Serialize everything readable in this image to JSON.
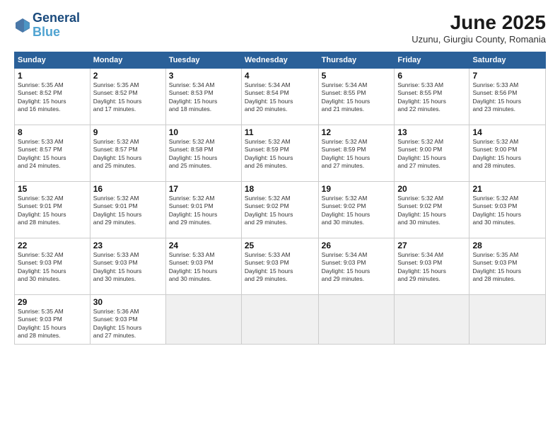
{
  "header": {
    "logo_line1": "General",
    "logo_line2": "Blue",
    "title": "June 2025",
    "subtitle": "Uzunu, Giurgiu County, Romania"
  },
  "weekdays": [
    "Sunday",
    "Monday",
    "Tuesday",
    "Wednesday",
    "Thursday",
    "Friday",
    "Saturday"
  ],
  "weeks": [
    [
      {
        "day": "1",
        "info": "Sunrise: 5:35 AM\nSunset: 8:52 PM\nDaylight: 15 hours\nand 16 minutes."
      },
      {
        "day": "2",
        "info": "Sunrise: 5:35 AM\nSunset: 8:52 PM\nDaylight: 15 hours\nand 17 minutes."
      },
      {
        "day": "3",
        "info": "Sunrise: 5:34 AM\nSunset: 8:53 PM\nDaylight: 15 hours\nand 18 minutes."
      },
      {
        "day": "4",
        "info": "Sunrise: 5:34 AM\nSunset: 8:54 PM\nDaylight: 15 hours\nand 20 minutes."
      },
      {
        "day": "5",
        "info": "Sunrise: 5:34 AM\nSunset: 8:55 PM\nDaylight: 15 hours\nand 21 minutes."
      },
      {
        "day": "6",
        "info": "Sunrise: 5:33 AM\nSunset: 8:55 PM\nDaylight: 15 hours\nand 22 minutes."
      },
      {
        "day": "7",
        "info": "Sunrise: 5:33 AM\nSunset: 8:56 PM\nDaylight: 15 hours\nand 23 minutes."
      }
    ],
    [
      {
        "day": "8",
        "info": "Sunrise: 5:33 AM\nSunset: 8:57 PM\nDaylight: 15 hours\nand 24 minutes."
      },
      {
        "day": "9",
        "info": "Sunrise: 5:32 AM\nSunset: 8:57 PM\nDaylight: 15 hours\nand 25 minutes."
      },
      {
        "day": "10",
        "info": "Sunrise: 5:32 AM\nSunset: 8:58 PM\nDaylight: 15 hours\nand 25 minutes."
      },
      {
        "day": "11",
        "info": "Sunrise: 5:32 AM\nSunset: 8:59 PM\nDaylight: 15 hours\nand 26 minutes."
      },
      {
        "day": "12",
        "info": "Sunrise: 5:32 AM\nSunset: 8:59 PM\nDaylight: 15 hours\nand 27 minutes."
      },
      {
        "day": "13",
        "info": "Sunrise: 5:32 AM\nSunset: 9:00 PM\nDaylight: 15 hours\nand 27 minutes."
      },
      {
        "day": "14",
        "info": "Sunrise: 5:32 AM\nSunset: 9:00 PM\nDaylight: 15 hours\nand 28 minutes."
      }
    ],
    [
      {
        "day": "15",
        "info": "Sunrise: 5:32 AM\nSunset: 9:01 PM\nDaylight: 15 hours\nand 28 minutes."
      },
      {
        "day": "16",
        "info": "Sunrise: 5:32 AM\nSunset: 9:01 PM\nDaylight: 15 hours\nand 29 minutes."
      },
      {
        "day": "17",
        "info": "Sunrise: 5:32 AM\nSunset: 9:01 PM\nDaylight: 15 hours\nand 29 minutes."
      },
      {
        "day": "18",
        "info": "Sunrise: 5:32 AM\nSunset: 9:02 PM\nDaylight: 15 hours\nand 29 minutes."
      },
      {
        "day": "19",
        "info": "Sunrise: 5:32 AM\nSunset: 9:02 PM\nDaylight: 15 hours\nand 30 minutes."
      },
      {
        "day": "20",
        "info": "Sunrise: 5:32 AM\nSunset: 9:02 PM\nDaylight: 15 hours\nand 30 minutes."
      },
      {
        "day": "21",
        "info": "Sunrise: 5:32 AM\nSunset: 9:03 PM\nDaylight: 15 hours\nand 30 minutes."
      }
    ],
    [
      {
        "day": "22",
        "info": "Sunrise: 5:32 AM\nSunset: 9:03 PM\nDaylight: 15 hours\nand 30 minutes."
      },
      {
        "day": "23",
        "info": "Sunrise: 5:33 AM\nSunset: 9:03 PM\nDaylight: 15 hours\nand 30 minutes."
      },
      {
        "day": "24",
        "info": "Sunrise: 5:33 AM\nSunset: 9:03 PM\nDaylight: 15 hours\nand 30 minutes."
      },
      {
        "day": "25",
        "info": "Sunrise: 5:33 AM\nSunset: 9:03 PM\nDaylight: 15 hours\nand 29 minutes."
      },
      {
        "day": "26",
        "info": "Sunrise: 5:34 AM\nSunset: 9:03 PM\nDaylight: 15 hours\nand 29 minutes."
      },
      {
        "day": "27",
        "info": "Sunrise: 5:34 AM\nSunset: 9:03 PM\nDaylight: 15 hours\nand 29 minutes."
      },
      {
        "day": "28",
        "info": "Sunrise: 5:35 AM\nSunset: 9:03 PM\nDaylight: 15 hours\nand 28 minutes."
      }
    ],
    [
      {
        "day": "29",
        "info": "Sunrise: 5:35 AM\nSunset: 9:03 PM\nDaylight: 15 hours\nand 28 minutes."
      },
      {
        "day": "30",
        "info": "Sunrise: 5:36 AM\nSunset: 9:03 PM\nDaylight: 15 hours\nand 27 minutes."
      },
      {
        "day": "",
        "info": ""
      },
      {
        "day": "",
        "info": ""
      },
      {
        "day": "",
        "info": ""
      },
      {
        "day": "",
        "info": ""
      },
      {
        "day": "",
        "info": ""
      }
    ]
  ]
}
